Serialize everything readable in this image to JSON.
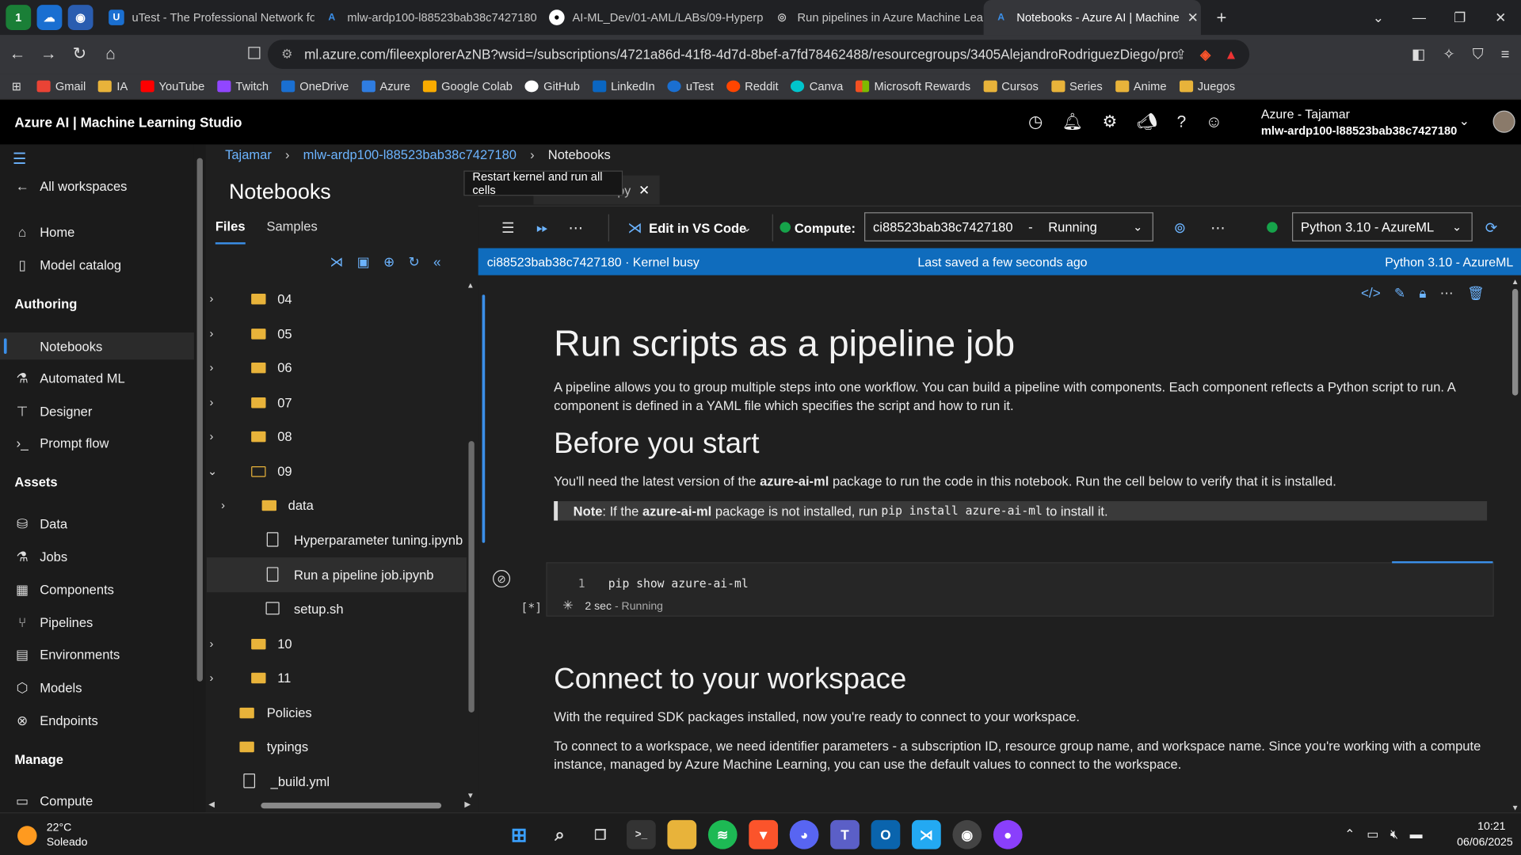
{
  "browser": {
    "tabs": [
      {
        "label": "uTest - The Professional Network for",
        "fav": "U",
        "color": "#1a6fd1"
      },
      {
        "label": "mlw-ardp100-l88523bab38c7427180",
        "fav": "A",
        "color": "#2f7de1"
      },
      {
        "label": "AI-ML_Dev/01-AML/LABs/09-Hyperp",
        "fav": "G",
        "color": "#444"
      },
      {
        "label": "Run pipelines in Azure Machine Learn",
        "fav": "◎",
        "color": "#555"
      },
      {
        "label": "Notebooks - Azure AI | Machine",
        "fav": "A",
        "color": "#2f7de1"
      }
    ],
    "url": "ml.azure.com/fileexplorerAzNB?wsid=/subscriptions/4721a86d-41f8-4d7d-8bef-a7fd78462488/resourcegroups/3405AlejandroRodriguezDiego/provi...",
    "bookmarks": [
      "Gmail",
      "IA",
      "YouTube",
      "Twitch",
      "OneDrive",
      "Azure",
      "Google Colab",
      "GitHub",
      "LinkedIn",
      "uTest",
      "Reddit",
      "Canva",
      "Microsoft Rewards",
      "Cursos",
      "Series",
      "Anime",
      "Juegos"
    ]
  },
  "studio": {
    "title": "Azure AI | Machine Learning Studio",
    "account_name": "Azure - Tajamar",
    "workspace": "mlw-ardp100-l88523bab38c7427180"
  },
  "nav": {
    "all_workspaces": "All workspaces",
    "home": "Home",
    "model_catalog": "Model catalog",
    "authoring": "Authoring",
    "notebooks": "Notebooks",
    "automated_ml": "Automated ML",
    "designer": "Designer",
    "prompt_flow": "Prompt flow",
    "assets": "Assets",
    "data": "Data",
    "jobs": "Jobs",
    "components": "Components",
    "pipelines": "Pipelines",
    "environments": "Environments",
    "models": "Models",
    "endpoints": "Endpoints",
    "manage": "Manage",
    "compute": "Compute"
  },
  "breadcrumb": [
    "Tajamar",
    "mlw-ardp100-l88523bab38c7427180",
    "Notebooks"
  ],
  "files": {
    "title": "Notebooks",
    "tab_files": "Files",
    "tab_samples": "Samples",
    "tree": [
      "04",
      "05",
      "06",
      "07",
      "08",
      "09",
      "data",
      "Hyperparameter tuning.ipynb",
      "Run a pipeline job.ipynb",
      "setup.sh",
      "10",
      "11",
      "Policies",
      "typings",
      "_build.yml"
    ]
  },
  "notebook": {
    "tab_suffix": "ipy",
    "tooltip": "Restart kernel and run all cells",
    "edit_vscode": "Edit in VS Code",
    "compute_label": "Compute:",
    "compute_name": "ci88523bab38c7427180",
    "compute_sep": "-",
    "compute_state": "Running",
    "kernel": "Python 3.10 - AzureML",
    "status_left": "ci88523bab38c7427180 · Kernel busy",
    "status_mid": "Last saved a few seconds ago",
    "status_right": "Python 3.10 - AzureML",
    "h1": "Run scripts as a pipeline job",
    "p1": "A pipeline allows you to group multiple steps into one workflow. You can build a pipeline with components. Each component reflects a Python script to run. A component is defined in a YAML file which specifies the script and how to run it.",
    "h2a": "Before you start",
    "p2_a": "You'll need the latest version of the ",
    "p2_b": "azure-ai-ml",
    "p2_c": " package to run the code in this notebook. Run the cell below to verify that it is installed.",
    "note_a": "Note",
    "note_b": ": If the ",
    "note_c": "azure-ai-ml",
    "note_d": " package is not installed, run ",
    "note_code": "pip install azure-ai-ml",
    "note_e": " to install it.",
    "cell_line_no": "1",
    "cell_code": "pip show azure-ai-ml",
    "cell_exec": "[*]",
    "cell_time": "2 sec",
    "cell_state": " - Running",
    "h2b": "Connect to your workspace",
    "p3": "With the required SDK packages installed, now you're ready to connect to your workspace.",
    "p4": "To connect to a workspace, we need identifier parameters - a subscription ID, resource group name, and workspace name. Since you're working with a compute instance, managed by Azure Machine Learning, you can use the default values to connect to the workspace."
  },
  "taskbar": {
    "temp": "22°C",
    "weather": "Soleado",
    "time": "10:21",
    "date": "06/06/2025"
  },
  "colors": {
    "accent": "#0f6cbd",
    "link": "#6cb4ff",
    "running": "#16a34a"
  }
}
